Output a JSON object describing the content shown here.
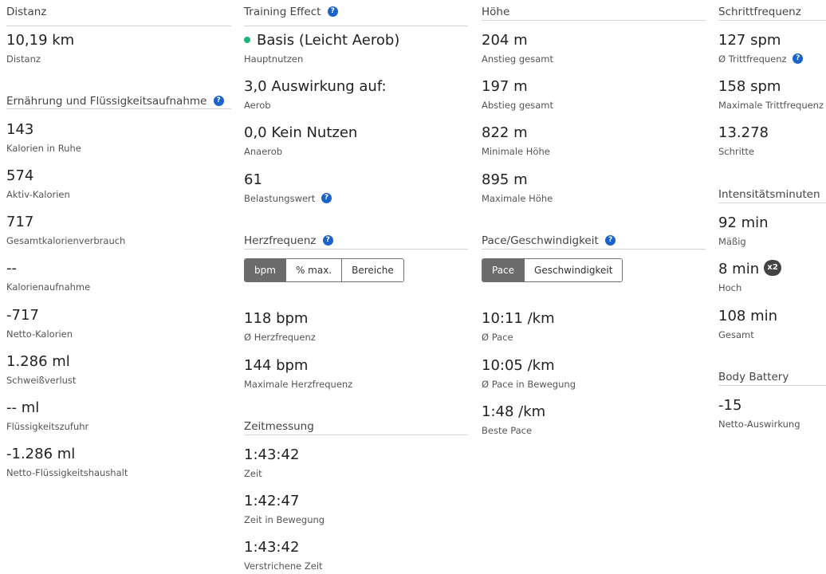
{
  "distanz": {
    "header": "Distanz",
    "stats": [
      {
        "value": "10,19 km",
        "label": "Distanz"
      }
    ]
  },
  "ernaehrung": {
    "header": "Ernährung und Flüssigkeitsaufnahme",
    "stats": [
      {
        "value": "143",
        "label": "Kalorien in Ruhe"
      },
      {
        "value": "574",
        "label": "Aktiv-Kalorien"
      },
      {
        "value": "717",
        "label": "Gesamtkalorienverbrauch"
      },
      {
        "value": "--",
        "label": "Kalorienaufnahme"
      },
      {
        "value": "-717",
        "label": "Netto-Kalorien"
      },
      {
        "value": "1.286 ml",
        "label": "Schweißverlust"
      },
      {
        "value": "-- ml",
        "label": "Flüssigkeitszufuhr"
      },
      {
        "value": "-1.286 ml",
        "label": "Netto-Flüssigkeitshaushalt"
      }
    ]
  },
  "training_effect": {
    "header": "Training Effect",
    "stats": [
      {
        "value": "Basis (Leicht Aerob)",
        "label": "Hauptnutzen"
      },
      {
        "value": "3,0 Auswirkung auf:",
        "label": "Aerob"
      },
      {
        "value": "0,0 Kein Nutzen",
        "label": "Anaerob"
      },
      {
        "value": "61",
        "label": "Belastungswert"
      }
    ],
    "dot_color": "#1bb57a"
  },
  "herzfrequenz": {
    "header": "Herzfrequenz",
    "toggle": [
      "bpm",
      "% max.",
      "Bereiche"
    ],
    "selected": "bpm",
    "stats": [
      {
        "value": "118 bpm",
        "label": "Ø Herzfrequenz"
      },
      {
        "value": "144 bpm",
        "label": "Maximale Herzfrequenz"
      }
    ]
  },
  "zeitmessung": {
    "header": "Zeitmessung",
    "stats": [
      {
        "value": "1:43:42",
        "label": "Zeit"
      },
      {
        "value": "1:42:47",
        "label": "Zeit in Bewegung"
      },
      {
        "value": "1:43:42",
        "label": "Verstrichene Zeit"
      }
    ]
  },
  "hoehe": {
    "header": "Höhe",
    "stats": [
      {
        "value": "204 m",
        "label": "Anstieg gesamt"
      },
      {
        "value": "197 m",
        "label": "Abstieg gesamt"
      },
      {
        "value": "822 m",
        "label": "Minimale Höhe"
      },
      {
        "value": "895 m",
        "label": "Maximale Höhe"
      }
    ]
  },
  "pace": {
    "header": "Pace/Geschwindigkeit",
    "toggle": [
      "Pace",
      "Geschwindigkeit"
    ],
    "selected": "Pace",
    "stats": [
      {
        "value": "10:11 /km",
        "label": "Ø Pace"
      },
      {
        "value": "10:05 /km",
        "label": "Ø Pace in Bewegung"
      },
      {
        "value": "1:48 /km",
        "label": "Beste Pace"
      }
    ]
  },
  "schrittfrequenz": {
    "header": "Schrittfrequenz",
    "stats": [
      {
        "value": "127 spm",
        "label": "Ø Trittfrequenz"
      },
      {
        "value": "158 spm",
        "label": "Maximale Trittfrequenz"
      },
      {
        "value": "13.278",
        "label": "Schritte"
      }
    ]
  },
  "intensitaet": {
    "header": "Intensitätsminuten",
    "stats": [
      {
        "value": "92 min",
        "label": "Mäßig"
      },
      {
        "value": "8 min",
        "label": "Hoch"
      },
      {
        "value": "108 min",
        "label": "Gesamt"
      }
    ],
    "badge": "x2"
  },
  "body_battery": {
    "header": "Body Battery",
    "stats": [
      {
        "value": "-15",
        "label": "Netto-Auswirkung"
      }
    ]
  },
  "colors": {
    "help_icon": "#1a63cc",
    "toggle_active": "#6b6b6b",
    "badge": "#444444"
  },
  "help_glyph": "?"
}
